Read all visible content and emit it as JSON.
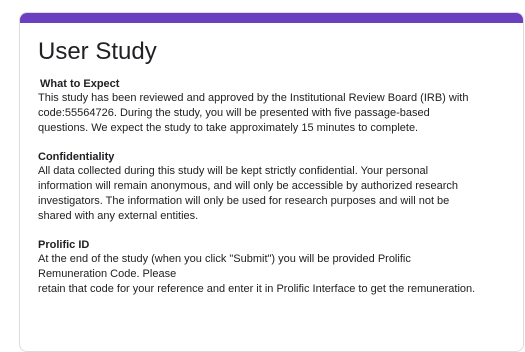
{
  "colors": {
    "accent": "#6a3fc0",
    "text": "#202124",
    "border": "#dadce0"
  },
  "form": {
    "title": "User Study",
    "sections": [
      {
        "heading": "What to Expect",
        "lines": [
          "This study has been reviewed and approved by the Institutional Review Board (IRB) with",
          "code:55564726. During the study, you will be presented with five passage-based",
          "questions. We expect the study to take approximately 15 minutes to complete."
        ]
      },
      {
        "heading": "Confidentiality",
        "lines": [
          "All data collected during this study will be kept strictly confidential. Your personal",
          "information will remain anonymous, and will only be accessible by authorized research",
          "investigators. The information will only be used for research purposes and will not be",
          "shared with any external entities."
        ]
      },
      {
        "heading": "Prolific ID",
        "lines": [
          "At the end of the study (when you click \"Submit\") you will be provided Prolific",
          "Remuneration Code. Please",
          "retain that code for your reference and enter it in Prolific Interface to get the remuneration."
        ]
      }
    ]
  }
}
